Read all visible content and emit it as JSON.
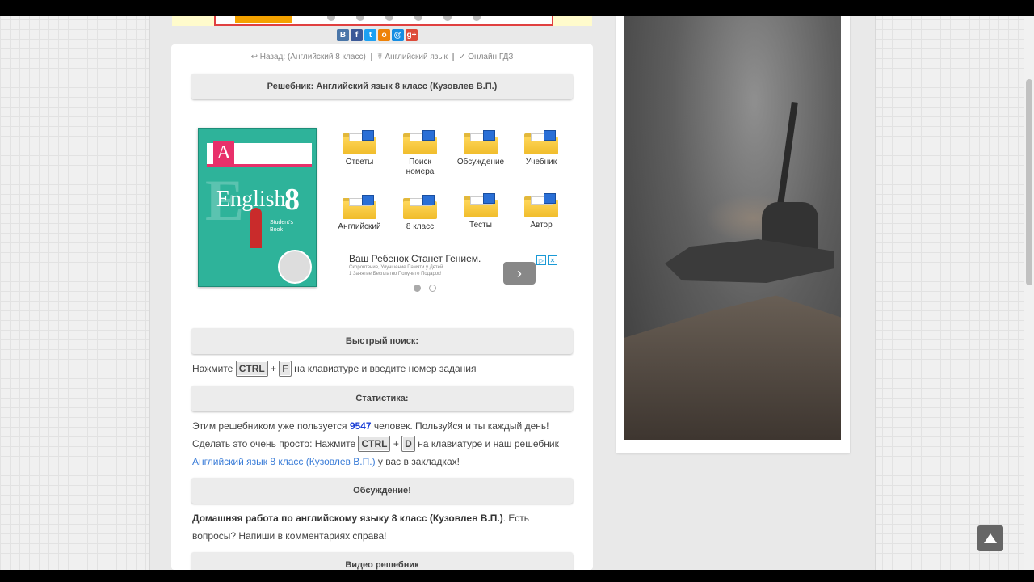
{
  "share_icons": [
    {
      "label": "В",
      "color": "#4a76a8"
    },
    {
      "label": "f",
      "color": "#3b5998"
    },
    {
      "label": "t",
      "color": "#1da1f2"
    },
    {
      "label": "о",
      "color": "#ee8208"
    },
    {
      "label": "@",
      "color": "#168de2"
    },
    {
      "label": "g+",
      "color": "#dd4b39"
    }
  ],
  "breadcrumb": {
    "back": "↩ Назад: (Английский 8 класс)",
    "subject": "☤ Английский язык",
    "online": "✓ Онлайн ГДЗ",
    "sep": "|"
  },
  "panels": {
    "title": "Решебник: Английский язык 8 класс (Кузовлев В.П.)",
    "quick_search": "Быстрый поиск:",
    "stats": "Статистика:",
    "discussion": "Обсуждение!",
    "video": "Видео решебник"
  },
  "book": {
    "letter": "A",
    "word": "English",
    "grade": "8",
    "subtitle": "Student's Book"
  },
  "folders": [
    {
      "label": "Ответы"
    },
    {
      "label": "Поиск номера"
    },
    {
      "label": "Обсуждение"
    },
    {
      "label": "Учебник"
    },
    {
      "label": "Английский"
    },
    {
      "label": "8 класс"
    },
    {
      "label": "Тесты"
    },
    {
      "label": "Автор"
    }
  ],
  "ad": {
    "title": "Ваш Ребенок Станет Гением.",
    "line1": "Скорочтение, Улучшение Памяти у Детей.",
    "line2": "1 Занятие Бесплатно Получите Подарок!",
    "arrow": "›"
  },
  "quick_search": {
    "before": "Нажмите",
    "key1": "CTRL",
    "plus": "+",
    "key2": "F",
    "after": "на клавиатуре и введите номер задания"
  },
  "stats": {
    "t1": "Этим решебником уже пользуется",
    "count": "9547",
    "t2": "человек. Пользуйся и ты каждый день! Сделать это очень просто: Нажмите",
    "key1": "CTRL",
    "plus": "+",
    "key2": "D",
    "t3": "на клавиатуре и наш решебник",
    "link": "Английский язык 8 класс (Кузовлев В.П.)",
    "t4": "у вас в закладках!"
  },
  "discussion": {
    "bold": "Домашняя работа по английскому языку 8 класс (Кузовлев В.П.)",
    "rest": ". Есть вопросы? Напиши в комментариях справа!"
  },
  "colors": {
    "accent_link": "#3b7dd8",
    "count": "#1b3fd6",
    "folder": "#f0bc2a",
    "book": "#2eb39a"
  }
}
